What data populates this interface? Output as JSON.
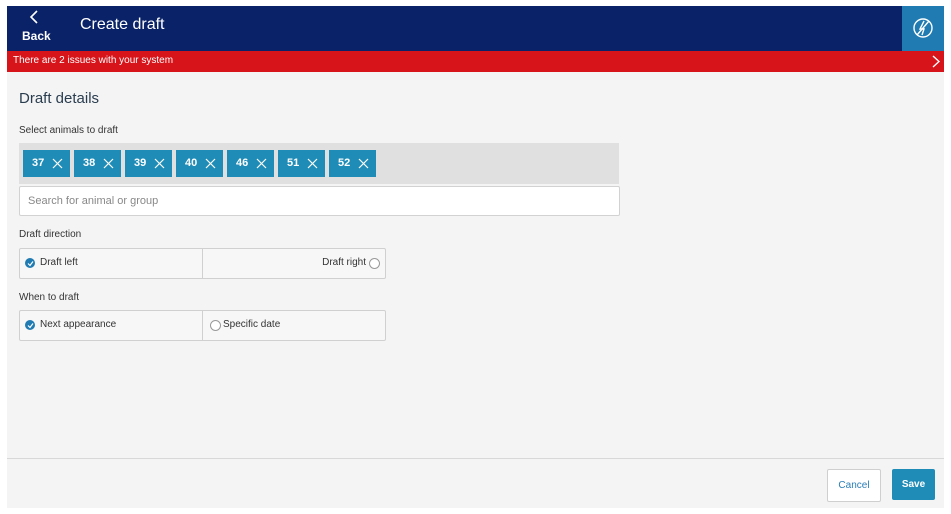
{
  "header": {
    "back_label": "Back",
    "title": "Create draft",
    "status_icon": "lightning-slash-icon"
  },
  "alert": {
    "text": "There are 2 issues with your system"
  },
  "form": {
    "section_title": "Draft details",
    "animals_label": "Select animals to draft",
    "animals": [
      "37",
      "38",
      "39",
      "40",
      "46",
      "51",
      "52"
    ],
    "search_placeholder": "Search for animal or group",
    "direction_label": "Draft direction",
    "direction_options": [
      "Draft left",
      "Draft right"
    ],
    "direction_selected": "Draft left",
    "when_label": "When to draft",
    "when_options": [
      "Next appearance",
      "Specific date"
    ],
    "when_selected": "Next appearance"
  },
  "footer": {
    "cancel_label": "Cancel",
    "save_label": "Save"
  },
  "colors": {
    "header": "#0a2268",
    "alert": "#d7141a",
    "accent": "#1f8cb8"
  }
}
